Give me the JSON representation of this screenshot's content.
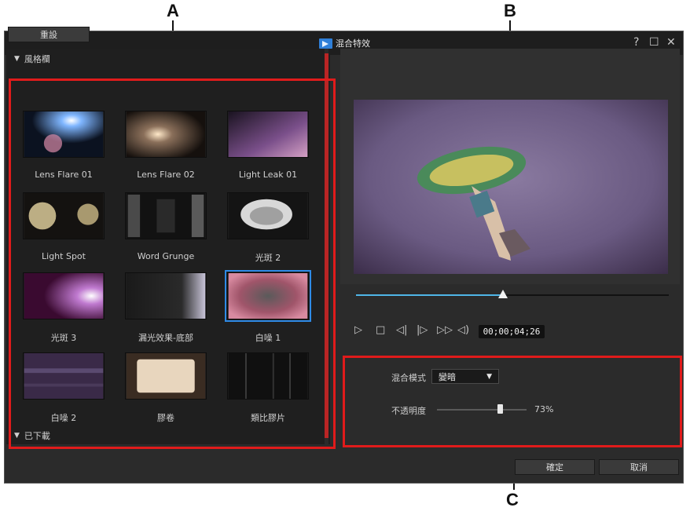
{
  "callouts": {
    "a": "A",
    "b": "B",
    "c": "C"
  },
  "window": {
    "title": "混合特效",
    "help": "?",
    "maximize": "☐",
    "close": "✕"
  },
  "toolbar": {
    "reset_label": "重設"
  },
  "library": {
    "category_style": "風格欄",
    "category_downloaded": "已下載",
    "items": [
      {
        "label": "Lens Flare 01"
      },
      {
        "label": "Lens Flare 02"
      },
      {
        "label": "Light Leak 01"
      },
      {
        "label": "Light Spot"
      },
      {
        "label": "Word Grunge"
      },
      {
        "label": "光斑 2"
      },
      {
        "label": "光斑 3"
      },
      {
        "label": "漏光效果-底部"
      },
      {
        "label": "白噪 1",
        "selected": true
      },
      {
        "label": "白噪 2"
      },
      {
        "label": "膠卷"
      },
      {
        "label": "類比膠片"
      }
    ]
  },
  "player": {
    "timecode": "00;00;04;26",
    "progress": 0.47
  },
  "settings": {
    "blend_mode_label": "混合模式",
    "blend_mode_value": "變暗",
    "opacity_label": "不透明度",
    "opacity_value": "73%"
  },
  "footer": {
    "ok_label": "確定",
    "cancel_label": "取消"
  },
  "colors": {
    "accent": "#2e8ae6",
    "highlight": "#e01b1b",
    "seek": "#4fb6e8"
  }
}
